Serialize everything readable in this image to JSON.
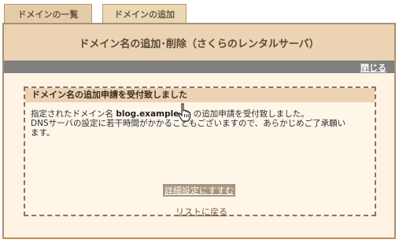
{
  "tabs": [
    {
      "label": "ドメインの一覧"
    },
    {
      "label": "ドメインの追加"
    }
  ],
  "panel": {
    "title": "ドメイン名の追加･削除（さくらのレンタルサーバ）",
    "close_label": "閉じる"
  },
  "message": {
    "title": "ドメイン名の追加申請を受付致しました",
    "line1_prefix": "指定されたドメイン名 ",
    "domain": "blog.example.jp",
    "line1_suffix": " の追加申請を受付致しました。",
    "line2": "DNSサーバの設定に若干時間がかかることもございますので、あらかじめご了承願い",
    "line3": "ます。",
    "detail_link": "詳細設定にすすむ",
    "back_link": "リストに戻る"
  },
  "colors": {
    "tab_bg": "#e3cda9",
    "header_bg": "#ebd3b3",
    "panel_bg": "#fff3e3",
    "bar": "#808080",
    "link": "#7a5a35"
  }
}
